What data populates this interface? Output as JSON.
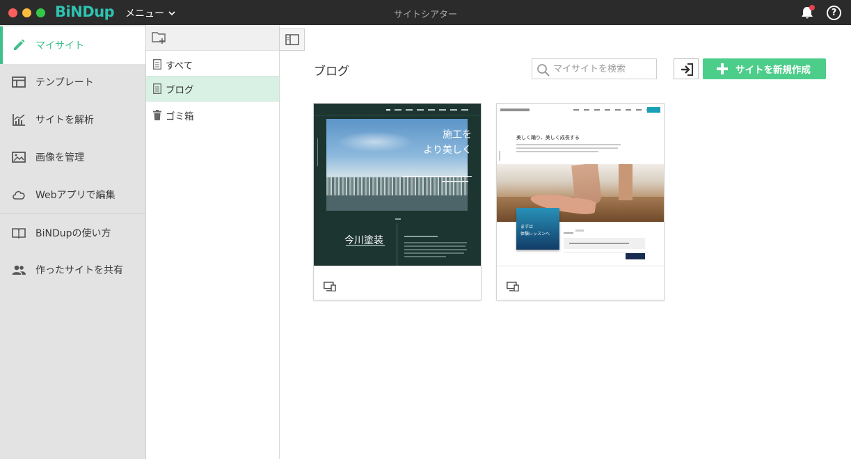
{
  "app": {
    "logo": "BiNDup",
    "menu_label": "メニュー",
    "window_title": "サイトシアター"
  },
  "sidebar": {
    "items": [
      {
        "label": "マイサイト",
        "icon": "pencil-icon",
        "active": true
      },
      {
        "label": "テンプレート",
        "icon": "template-icon"
      },
      {
        "label": "サイトを解析",
        "icon": "chart-icon"
      },
      {
        "label": "画像を管理",
        "icon": "image-icon"
      },
      {
        "label": "Webアプリで編集",
        "icon": "cloud-icon"
      },
      {
        "label": "BiNDupの使い方",
        "icon": "book-icon"
      },
      {
        "label": "作ったサイトを共有",
        "icon": "people-icon"
      }
    ]
  },
  "folders": {
    "items": [
      {
        "label": "すべて",
        "icon": "document-icon"
      },
      {
        "label": "ブログ",
        "icon": "document-icon",
        "active": true
      },
      {
        "label": "ゴミ箱",
        "icon": "trash-icon"
      }
    ]
  },
  "main": {
    "title": "ブログ",
    "search_placeholder": "マイサイトを検索",
    "new_site_label": "サイトを新規作成"
  },
  "cards": [
    {
      "hero_line1": "施工を",
      "hero_line2": "より美しく",
      "company_name": "今川塗装"
    },
    {
      "headline": "美しく踊り、美しく成長する",
      "box_line1": "まずは",
      "box_line2": "体験レッスンへ"
    }
  ],
  "colors": {
    "accent": "#3fc08a",
    "button": "#4ccd8a",
    "titlebar": "#2b2b2b",
    "notification_dot": "#e7424c",
    "logo": "#2fc3b1"
  }
}
